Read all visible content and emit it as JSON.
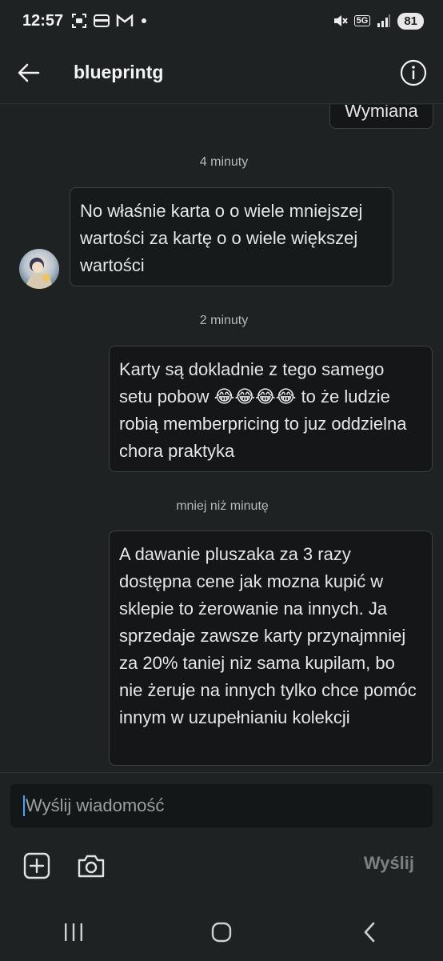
{
  "status_bar": {
    "time": "12:57",
    "network": "5G",
    "battery": "81",
    "icons": [
      "scan-icon",
      "wallet-icon",
      "gmail-icon",
      "dot-icon",
      "mute-icon",
      "signal-icon"
    ]
  },
  "header": {
    "title": "blueprintg",
    "back_icon": "arrow-left-icon",
    "info_icon": "info-icon"
  },
  "messages": [
    {
      "type": "sent",
      "text": "Wymiana",
      "partial": true
    },
    {
      "type": "timestamp",
      "text": "4 minuty"
    },
    {
      "type": "received",
      "text": "No właśnie karta o o wiele mniejszej wartości za kartę o o wiele większej wartości"
    },
    {
      "type": "timestamp",
      "text": "2 minuty"
    },
    {
      "type": "sent",
      "text": "Karty są dokladnie z tego samego setu pobow 😂😂😂😂 to że ludzie robią memberpricing to juz oddzielna chora praktyka"
    },
    {
      "type": "timestamp",
      "text": "mniej niż minutę"
    },
    {
      "type": "sent",
      "text": "A dawanie pluszaka za 3 razy dostępna cene jak mozna kupić w sklepie to żerowanie na innych. Ja sprzedaje zawsze karty przynajmniej za 20% taniej niz sama kupilam, bo nie żeruje na innych tylko chce pomóc innym w uzupełnianiu kolekcji"
    }
  ],
  "composer": {
    "placeholder": "Wyślij wiadomość",
    "send_label": "Wyślij",
    "add_icon": "plus-square-icon",
    "camera_icon": "camera-icon"
  },
  "nav_bar": {
    "icons": [
      "recents-icon",
      "home-icon",
      "back-icon"
    ]
  },
  "colors": {
    "background": "#1f2223",
    "bubble_border": "#3a4143",
    "text": "#e4e6e7",
    "muted": "#b5babc",
    "caret": "#4aa3ff"
  }
}
